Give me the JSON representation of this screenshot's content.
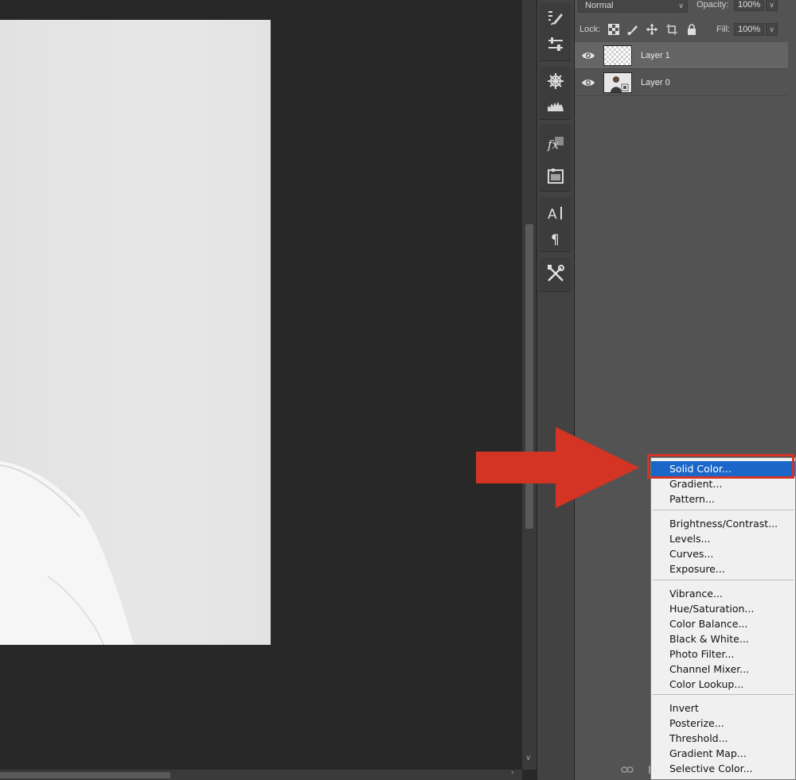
{
  "layers_panel": {
    "blend_mode": "Normal",
    "opacity_label": "Opacity:",
    "opacity_value": "100%",
    "lock_label": "Lock:",
    "fill_label": "Fill:",
    "fill_value": "100%",
    "layers": [
      {
        "name": "Layer 1",
        "selected": true,
        "visible": true,
        "thumbnail": "transparent-checkerboard"
      },
      {
        "name": "Layer 0",
        "selected": false,
        "visible": true,
        "thumbnail": "photo-portrait"
      }
    ]
  },
  "panel_dock": {
    "icons": [
      "brush-settings-icon",
      "adjustments-sliders-icon",
      "navigator-wheel-icon",
      "histogram-icon",
      "layer-styles-fx-icon",
      "swatches-image-icon",
      "character-text-icon",
      "paragraph-icon",
      "tools-crossed-icon"
    ]
  },
  "adjustment_menu": {
    "groups": [
      [
        "Solid Color...",
        "Gradient...",
        "Pattern..."
      ],
      [
        "Brightness/Contrast...",
        "Levels...",
        "Curves...",
        "Exposure..."
      ],
      [
        "Vibrance...",
        "Hue/Saturation...",
        "Color Balance...",
        "Black & White...",
        "Photo Filter...",
        "Channel Mixer...",
        "Color Lookup..."
      ],
      [
        "Invert",
        "Posterize...",
        "Threshold...",
        "Gradient Map...",
        "Selective Color..."
      ]
    ],
    "highlighted_item": "Solid Color..."
  },
  "colors": {
    "canvas_bg": "#282828",
    "panel_bg": "#535353",
    "menu_highlight": "#1a66c9",
    "annotation_red": "#d33424"
  }
}
